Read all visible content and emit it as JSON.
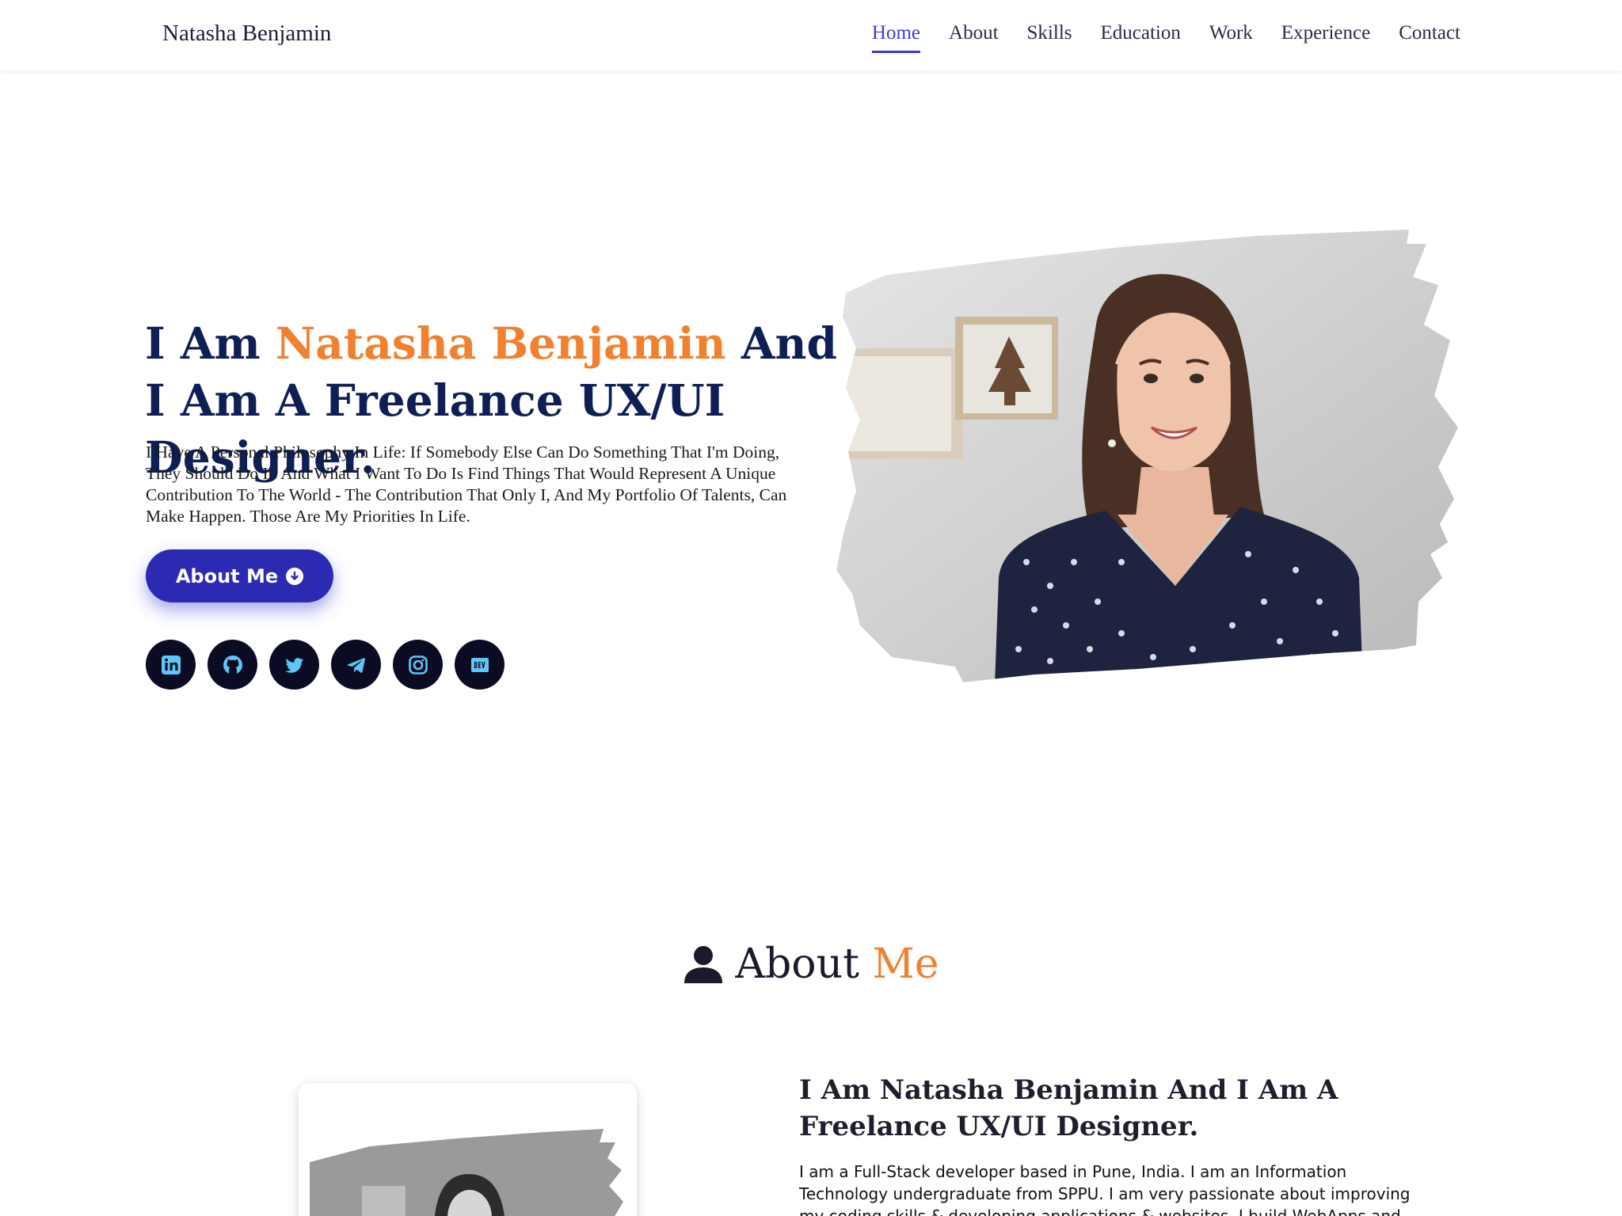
{
  "header": {
    "brand": "Natasha Benjamin",
    "nav": [
      "Home",
      "About",
      "Skills",
      "Education",
      "Work",
      "Experience",
      "Contact"
    ],
    "active": "Home"
  },
  "hero": {
    "title_prefix": "I Am ",
    "title_name": "Natasha Benjamin",
    "title_suffix": " And I Am A Freelance UX/UI Designer.",
    "description": "I Have A Personal Philosophy In Life: If Somebody Else Can Do Something That I'm Doing, They Should Do It. And What I Want To Do Is Find Things That Would Represent A Unique Contribution To The World - The Contribution That Only I, And My Portfolio Of Talents, Can Make Happen. Those Are My Priorities In Life.",
    "button_label": "About Me",
    "socials": [
      "linkedin-icon",
      "github-icon",
      "twitter-icon",
      "telegram-icon",
      "instagram-icon",
      "dev-icon"
    ]
  },
  "about": {
    "heading_word1": "About",
    "heading_word2": "Me",
    "subtitle": "I Am Natasha Benjamin And I Am A Freelance UX/UI Designer.",
    "text": "I am a Full-Stack developer based in Pune, India. I am an Information Technology undergraduate from SPPU. I am very passionate about improving my coding skills & developing applications & websites. I build WebApps and"
  },
  "colors": {
    "accent": "#f0812f",
    "primary": "#2c2ab3",
    "heading": "#0e1f56",
    "nav_active": "#3b3bdc",
    "social_bg": "#0c0b24",
    "social_icon": "#5bc8f5"
  }
}
